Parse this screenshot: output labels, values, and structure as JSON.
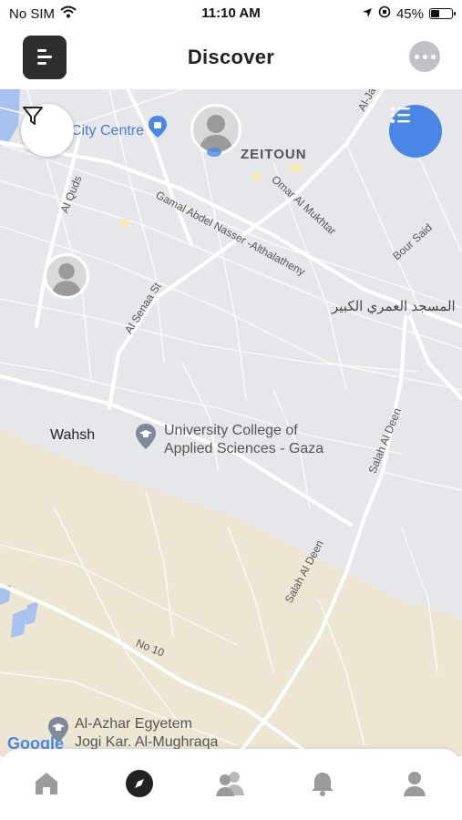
{
  "status_bar": {
    "carrier": "No SIM",
    "time": "11:10 AM",
    "battery": "45%",
    "battery_fraction": 0.45
  },
  "header": {
    "title": "Discover"
  },
  "map": {
    "labels": {
      "city_centre": "City Centre",
      "zeitoun": "ZEITOUN",
      "al_jala": "Al-Jala",
      "omar_al_mukhtar": "Omar Al Mukhtar",
      "al_quds": "Al Quds",
      "gamal_abdel_nasser": "Gamal Abdel Nasser -Althalatheny",
      "bour_said": "Bour Said",
      "mosque": "المسجد العمري الكبير",
      "al_senaa": "Al Senaa St",
      "wahsh": "Wahsh",
      "ucas_line1": "University College of",
      "ucas_line2": "Applied Sciences - Gaza",
      "salah_al_deen_1": "Salah Al Deen",
      "salah_al_deen_2": "Salah Al Deen",
      "no_10": "No 10",
      "al_azhar": "Al-Azhar Egyetem",
      "jogi_kar": "Jogi Kar. Al-Mughraqa",
      "google": "Google"
    }
  },
  "icons": {
    "menu": "menu-icon",
    "chat": "chat-bubble-icon",
    "filter": "filter-icon",
    "list": "list-icon",
    "tabs": [
      "home-icon",
      "compass-icon",
      "friends-icon",
      "bell-icon",
      "profile-icon"
    ]
  },
  "colors": {
    "accent": "#4a86e8",
    "dark": "#2e2e2e",
    "map_sand": "#ede6d3",
    "map_bg": "#e6e7ea"
  }
}
